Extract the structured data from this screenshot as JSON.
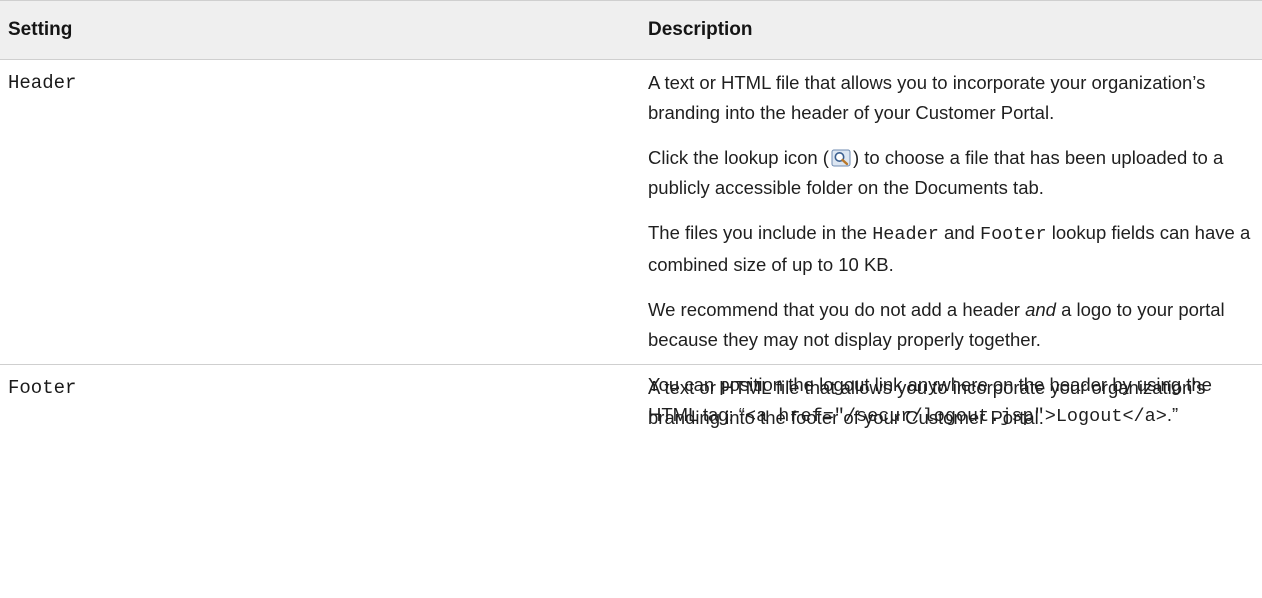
{
  "table": {
    "headers": {
      "setting": "Setting",
      "description": "Description"
    },
    "rows": [
      {
        "setting": "Header",
        "p1": "A text or HTML file that allows you to incorporate your organization’s branding into the header of your Customer Portal.",
        "p2_before": "Click the lookup icon (",
        "p2_after": ") to choose a file that has been uploaded to a publicly accessible folder on the Documents tab.",
        "p3_a": "The files you include in the ",
        "p3_code1": "Header",
        "p3_b": " and ",
        "p3_code2": "Footer",
        "p3_c": " lookup fields can have a combined size of up to 10 KB.",
        "p4_a": "We recommend that you do not add a header ",
        "p4_em": "and",
        "p4_b": " a logo to your portal because they may not display properly together.",
        "p5_a": "You can position the logout link anywhere on the header by using the HTML tag: “",
        "p5_code": "<a href=\"/secur/logout.jsp\">Logout</a>",
        "p5_b": ".”"
      },
      {
        "setting": "Footer",
        "p1": "A text or HTML file that allows you to incorporate your organization’s branding into the footer of your Customer Portal."
      }
    ]
  },
  "icons": {
    "lookup": "lookup-magnifier-icon"
  }
}
